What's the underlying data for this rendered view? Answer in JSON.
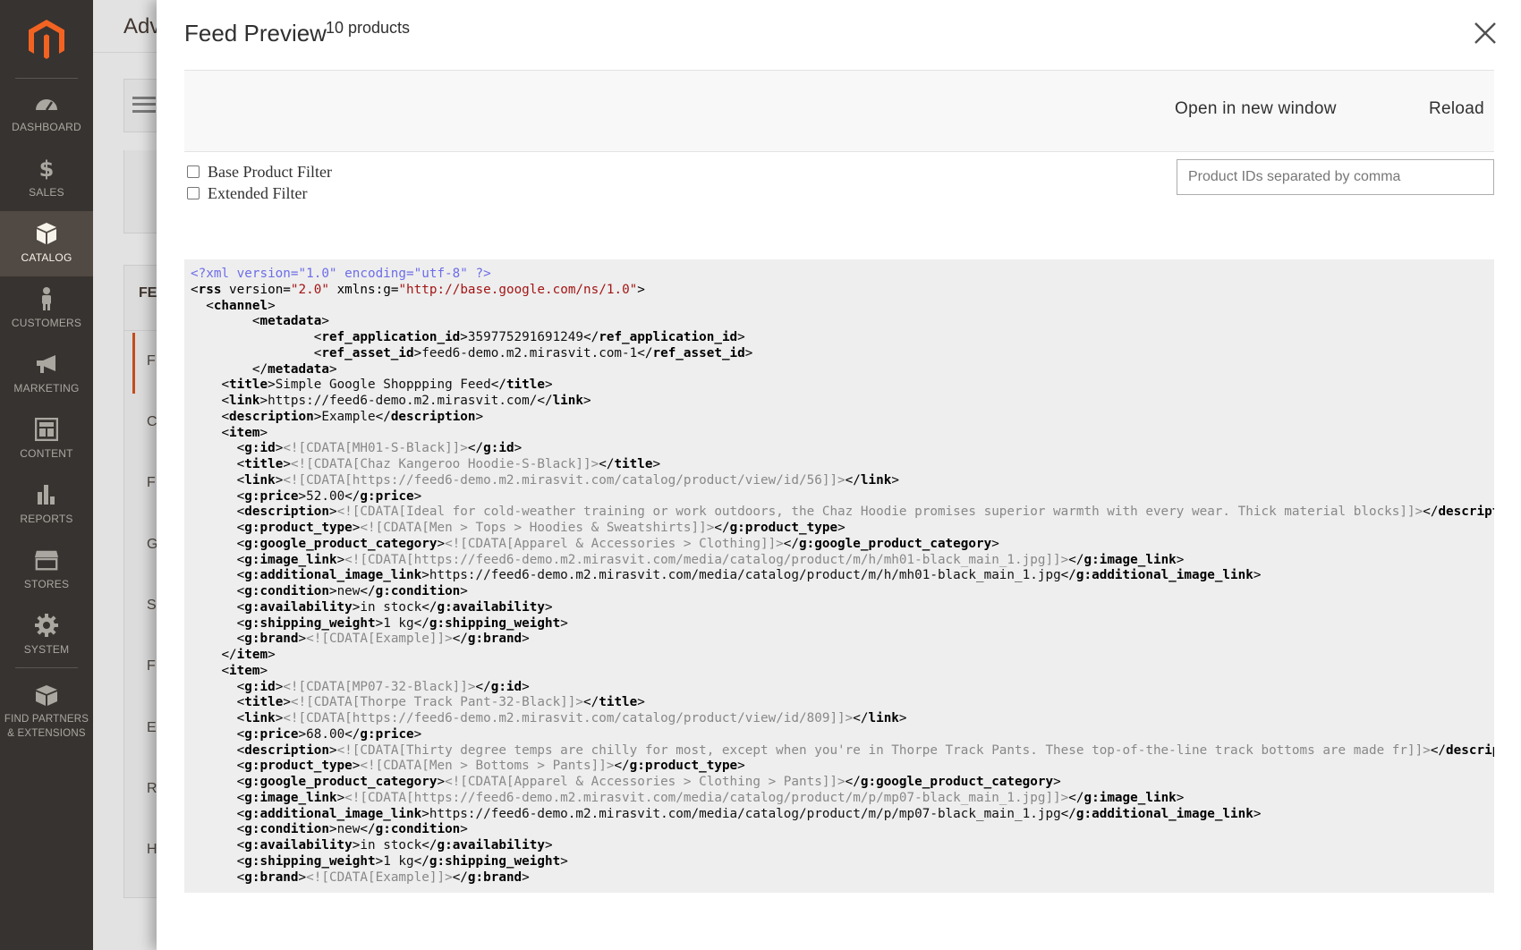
{
  "sidebar": {
    "items": [
      {
        "label": "DASHBOARD",
        "icon": "dashboard-icon"
      },
      {
        "label": "SALES",
        "icon": "dollar-icon"
      },
      {
        "label": "CATALOG",
        "icon": "catalog-box-icon"
      },
      {
        "label": "CUSTOMERS",
        "icon": "customer-person-icon"
      },
      {
        "label": "MARKETING",
        "icon": "megaphone-icon"
      },
      {
        "label": "CONTENT",
        "icon": "content-layout-icon"
      },
      {
        "label": "REPORTS",
        "icon": "bar-chart-icon"
      },
      {
        "label": "STORES",
        "icon": "store-icon"
      },
      {
        "label": "SYSTEM",
        "icon": "gear-icon"
      }
    ],
    "partners_line1": "FIND PARTNERS",
    "partners_line2": "& EXTENSIONS",
    "active": "CATALOG"
  },
  "background": {
    "header_title": "Adv",
    "panel_title": "FE",
    "letters": [
      "F",
      "C",
      "F",
      "G",
      "S",
      "F",
      "E",
      "R",
      "H"
    ]
  },
  "modal": {
    "title": "Feed Preview",
    "count": "10 products",
    "open_label": "Open in new window",
    "reload_label": "Reload",
    "filter_base": "Base Product Filter",
    "filter_extended": "Extended Filter",
    "ids_placeholder": "Product IDs separated by comma"
  },
  "xml": {
    "declaration": "<?xml version=\"1.0\" encoding=\"utf-8\" ?>",
    "rss_version": "2.0",
    "rss_ns": "http://base.google.com/ns/1.0",
    "ref_application_id": "359775291691249",
    "ref_asset_id": "feed6-demo.m2.mirasvit.com-1",
    "channel_title": "Simple Google Shoppping Feed",
    "channel_link": "https://feed6-demo.m2.mirasvit.com/",
    "channel_description": "Example",
    "items": [
      {
        "id": "MH01-S-Black",
        "title": "Chaz Kangeroo Hoodie-S-Black",
        "link": "https://feed6-demo.m2.mirasvit.com/catalog/product/view/id/56",
        "price": "52.00",
        "description": "Ideal for cold-weather training or work outdoors, the Chaz Hoodie promises superior warmth with every wear. Thick material blocks",
        "product_type": "Men > Tops > Hoodies & Sweatshirts",
        "google_product_category": "Apparel & Accessories > Clothing",
        "image_link": "https://feed6-demo.m2.mirasvit.com/media/catalog/product/m/h/mh01-black_main_1.jpg",
        "additional_image_link": "https://feed6-demo.m2.mirasvit.com/media/catalog/product/m/h/mh01-black_main_1.jpg",
        "condition": "new",
        "availability": "in stock",
        "shipping_weight": "1 kg",
        "brand": "Example"
      },
      {
        "id": "MP07-32-Black",
        "title": "Thorpe Track Pant-32-Black",
        "link": "https://feed6-demo.m2.mirasvit.com/catalog/product/view/id/809",
        "price": "68.00",
        "description": "Thirty degree temps are chilly for most, except when you're in Thorpe Track Pants. These top-of-the-line track bottoms are made fr",
        "product_type": "Men > Bottoms > Pants",
        "google_product_category": "Apparel & Accessories > Clothing > Pants",
        "image_link": "https://feed6-demo.m2.mirasvit.com/media/catalog/product/m/p/mp07-black_main_1.jpg",
        "additional_image_link": "https://feed6-demo.m2.mirasvit.com/media/catalog/product/m/p/mp07-black_main_1.jpg",
        "condition": "new",
        "availability": "in stock",
        "shipping_weight": "1 kg",
        "brand": "Example"
      }
    ]
  }
}
